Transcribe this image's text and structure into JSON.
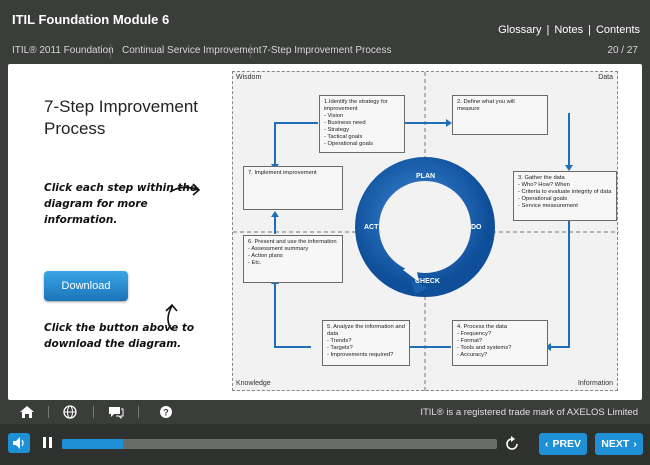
{
  "header": {
    "module_title": "ITIL Foundation Module 6",
    "links": [
      "Glossary",
      "Notes",
      "Contents"
    ],
    "breadcrumbs": [
      "ITIL® 2011 Foundation",
      "Continual Service Improvement",
      "7-Step Improvement Process"
    ],
    "page_count": "20 / 27"
  },
  "slide": {
    "title_line1": "7-Step Improvement",
    "title_line2": "Process",
    "instruction1": "Click each step within the diagram for more information.",
    "download_label": "Download",
    "instruction2": "Click the button above to download the diagram."
  },
  "diagram": {
    "quadrants": {
      "top_left": "Wisdom",
      "top_right": "Data",
      "bottom_left": "Knowledge",
      "bottom_right": "Information"
    },
    "wheel": {
      "plan": "PLAN",
      "do": "DO",
      "check": "CHECK",
      "act": "ACT"
    },
    "steps": {
      "s1": [
        "1.Identify the strategy for",
        "improvement",
        "- Vision",
        "- Business need",
        "- Strategy",
        "- Tactical goals",
        "- Operational goals"
      ],
      "s2": [
        "2. Define what you will",
        "measure"
      ],
      "s3": [
        "3. Gather the data",
        "- Who? How? When",
        "   - Criteria to evaluate integrity of data",
        "- Operational goals",
        "- Service measurement"
      ],
      "s4": [
        "4. Process the data",
        "- Frequency?",
        "- Format?",
        "- Tools and systems?",
        "- Accuracy?"
      ],
      "s5": [
        "5. Analyze the information and",
        "data",
        "- Trends?",
        "- Targets?",
        "- Improvements required?"
      ],
      "s6": [
        "6. Present and use the information",
        "- Assessment summary",
        "- Action plans",
        "- Etc."
      ],
      "s7": [
        "7. Implement improvement"
      ]
    }
  },
  "footer": {
    "trademark": "ITIL® is a registered trade mark of AXELOS Limited",
    "icons": [
      "home-icon",
      "globe-icon",
      "chat-icon",
      "help-icon"
    ]
  },
  "controls": {
    "progress": 0.14,
    "prev_label": "PREV",
    "next_label": "NEXT",
    "accent": "#1e90d6"
  }
}
